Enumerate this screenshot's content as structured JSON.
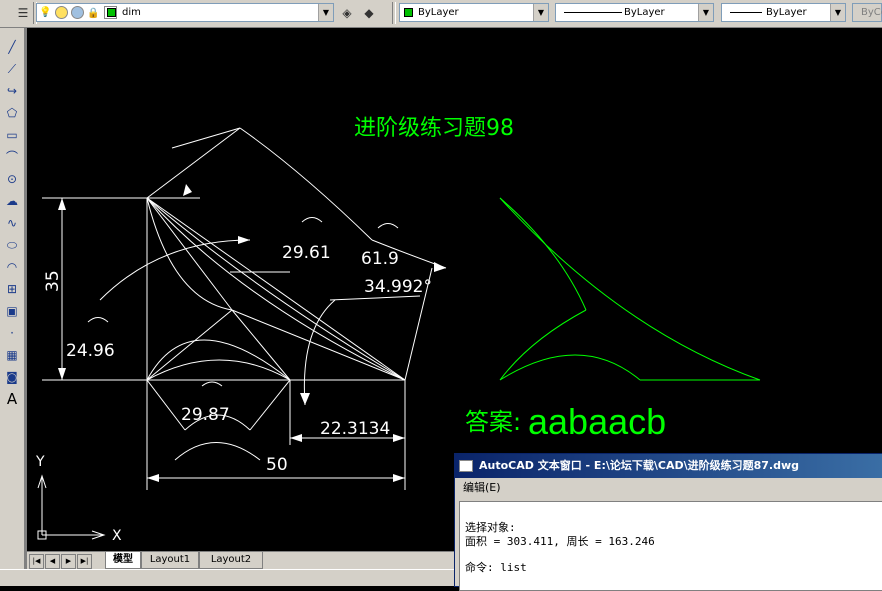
{
  "toolbar": {
    "layer_value": "dim",
    "color_value": "ByLayer",
    "linetype_value": "ByLayer",
    "lineweight_value": "ByLayer",
    "plotstyle_value": "ByCo",
    "layer_swatch_color": "#00c000",
    "color_swatch_color": "#00c000"
  },
  "left_toolbar": {
    "tools": [
      "line-icon",
      "construction-line-icon",
      "polyline-icon",
      "polygon-icon",
      "rectangle-icon",
      "arc-icon",
      "circle-icon",
      "revision-cloud-icon",
      "spline-icon",
      "ellipse-icon",
      "ellipse-arc-icon",
      "insert-block-icon",
      "make-block-icon",
      "point-icon",
      "hatch-icon",
      "region-icon",
      "multiline-text-icon"
    ],
    "text_tool_label": "A"
  },
  "drawing": {
    "title": "进阶级练习题98",
    "answer_label": "答案:",
    "answer_value": "aabaacb",
    "dims": {
      "d35": "35",
      "d24_96": "24.96",
      "d29_87": "29.87",
      "d50": "50",
      "d22_3134": "22.3134",
      "d29_61": "29.61",
      "d61_9": "61.9",
      "d34_992": "34.992°"
    },
    "ucs_x": "X",
    "ucs_y": "Y",
    "line_color": "#ffffff",
    "text_color": "#00ff00"
  },
  "tabs": {
    "model": "模型",
    "layout1": "Layout1",
    "layout2": "Layout2",
    "nav": [
      "|◀",
      "◀",
      "▶",
      "▶|"
    ]
  },
  "text_window": {
    "title": "AutoCAD 文本窗口 - E:\\论坛下载\\CAD\\进阶级练习题87.dwg",
    "menu_edit": "编辑(E)",
    "lines": [
      "选择对象:",
      "面积 = 303.411, 周长 = 163.246",
      "",
      "命令: list"
    ]
  }
}
